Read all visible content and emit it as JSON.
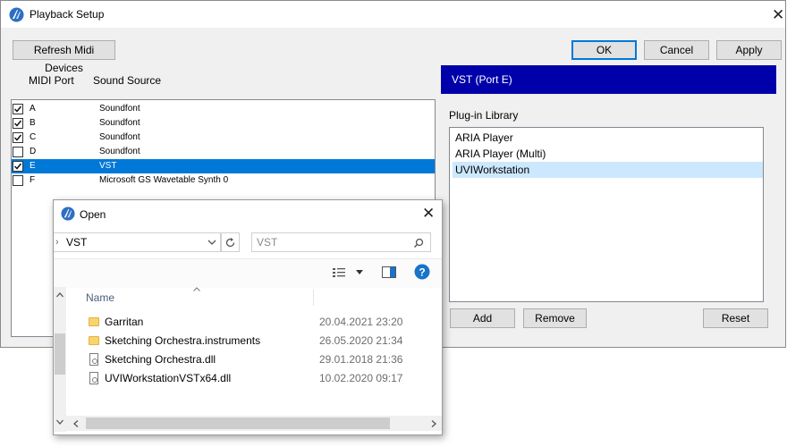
{
  "main_window": {
    "title": "Playback Setup",
    "close_glyph": "✕",
    "buttons": {
      "refresh": "Refresh Midi Devices",
      "ok": "OK",
      "cancel": "Cancel",
      "apply": "Apply"
    },
    "port_list": {
      "headers": {
        "port": "MIDI Port",
        "source": "Sound Source"
      },
      "rows": [
        {
          "port": "A",
          "source": "Soundfont",
          "checked": true,
          "selected": false
        },
        {
          "port": "B",
          "source": "Soundfont",
          "checked": true,
          "selected": false
        },
        {
          "port": "C",
          "source": "Soundfont",
          "checked": true,
          "selected": false
        },
        {
          "port": "D",
          "source": "Soundfont",
          "checked": false,
          "selected": false
        },
        {
          "port": "E",
          "source": "VST",
          "checked": true,
          "selected": true
        },
        {
          "port": "F",
          "source": "Microsoft GS Wavetable Synth 0",
          "checked": false,
          "selected": false
        }
      ]
    },
    "vst_header": "VST (Port E)",
    "plugin_library": {
      "label": "Plug-in Library",
      "items": [
        {
          "name": "ARIA Player",
          "selected": false
        },
        {
          "name": "ARIA Player (Multi)",
          "selected": false
        },
        {
          "name": "UVIWorkstation",
          "selected": true
        }
      ],
      "buttons": {
        "add": "Add",
        "remove": "Remove",
        "reset": "Reset"
      }
    }
  },
  "open_dialog": {
    "title": "Open",
    "close_glyph": "✕",
    "path": "VST",
    "search_placeholder": "VST",
    "column_name": "Name",
    "files": [
      {
        "name": "Garritan",
        "date": "20.04.2021 23:20",
        "type": "folder"
      },
      {
        "name": "Sketching Orchestra.instruments",
        "date": "26.05.2020 21:34",
        "type": "folder"
      },
      {
        "name": "Sketching Orchestra.dll",
        "date": "29.01.2018 21:36",
        "type": "dll"
      },
      {
        "name": "UVIWorkstationVSTx64.dll",
        "date": "10.02.2020 09:17",
        "type": "dll"
      }
    ]
  },
  "colors": {
    "vst_header_bg": "#0000aa",
    "selection_blue": "#0078d7",
    "plugin_selection": "#cce8ff",
    "help_icon": "#1a73c8"
  },
  "icons": {
    "app_logo": "app-logo-icon",
    "refresh": "refresh-icon",
    "search": "search-icon",
    "help": "help-icon"
  }
}
